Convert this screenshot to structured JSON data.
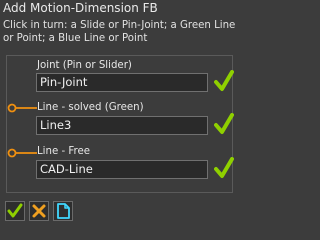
{
  "dialog": {
    "title": "Add Motion-Dimension FB",
    "instructions": "Click in turn: a Slide or Pin-Joint; a Green Line or Point; a Blue Line or Point"
  },
  "fields": [
    {
      "label": "Joint (Pin or Slider)",
      "value": "Pin-Joint",
      "status_icon": "check-icon"
    },
    {
      "label": "Line - solved (Green)",
      "value": "Line3",
      "status_icon": "check-icon"
    },
    {
      "label": "Line - Free",
      "value": "CAD-Line",
      "status_icon": "check-icon"
    }
  ],
  "toolbar": {
    "buttons": [
      {
        "icon": "check-icon",
        "color": "#8fd000"
      },
      {
        "icon": "close-icon",
        "color": "#f0a020"
      },
      {
        "icon": "document-icon",
        "color": "#40d8ff"
      }
    ]
  },
  "colors": {
    "background": "#3c3c3c",
    "accent_check": "#8fd000",
    "connector": "#f09010",
    "text": "#e8e8e8"
  }
}
